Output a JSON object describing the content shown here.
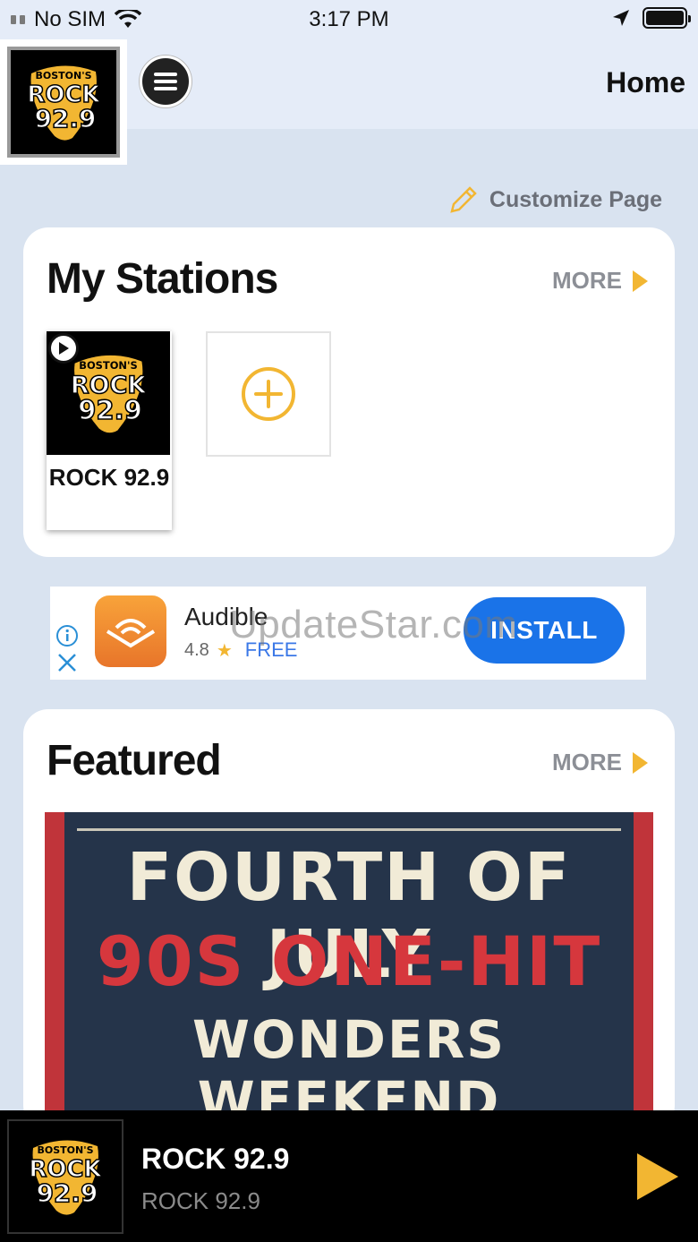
{
  "status_bar": {
    "carrier": "No SIM",
    "time": "3:17 PM"
  },
  "header": {
    "title": "Home",
    "logo": {
      "top": "BOSTON'S",
      "mid": "ROCK",
      "bottom": "92.9"
    }
  },
  "customize": {
    "label": "Customize Page"
  },
  "my_stations": {
    "title": "My Stations",
    "more_label": "MORE",
    "stations": [
      {
        "name": "ROCK 92.9"
      }
    ]
  },
  "ad": {
    "app_name": "Audible",
    "rating": "4.8",
    "price": "FREE",
    "install_label": "INSTALL",
    "watermark": "UpdateStar.com"
  },
  "featured": {
    "title": "Featured",
    "more_label": "MORE",
    "banner": {
      "line1": "FOURTH OF JULY",
      "line2": "90S ONE-HIT",
      "line3": "WONDERS WEEKEND"
    }
  },
  "player": {
    "title": "ROCK 92.9",
    "subtitle": "ROCK 92.9"
  },
  "colors": {
    "accent": "#f2b632",
    "background": "#d9e3f0",
    "install_blue": "#1a73e8"
  }
}
